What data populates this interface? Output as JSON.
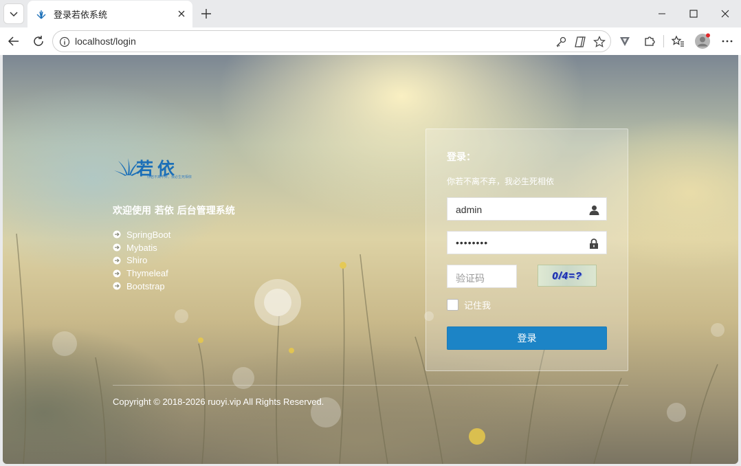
{
  "browser": {
    "tab": {
      "title": "登录若依系统"
    },
    "address": {
      "url": "localhost/login"
    }
  },
  "page": {
    "logo": {
      "text": "若依",
      "slogan": "你若不离不弃，我必生死相依"
    },
    "welcome": "欢迎使用 若依 后台管理系统",
    "tech_list": [
      "SpringBoot",
      "Mybatis",
      "Shiro",
      "Thymeleaf",
      "Bootstrap"
    ],
    "copyright": "Copyright © 2018-2026 ruoyi.vip All Rights Reserved."
  },
  "login": {
    "title": "登录：",
    "subtitle": "你若不离不弃，我必生死相依",
    "username": "admin",
    "password_masked": "••••••••",
    "captcha_placeholder": "验证码",
    "captcha_image_text": "0/4=?",
    "remember_label": "记住我",
    "submit_label": "登录"
  },
  "colors": {
    "accent": "#1c84c6",
    "logo_blue": "#1b6fb8"
  }
}
